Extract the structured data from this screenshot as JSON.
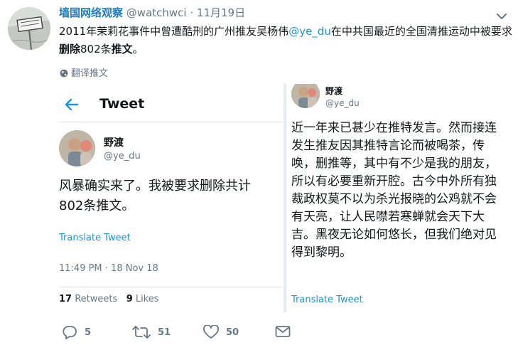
{
  "tweet": {
    "display_name": "墙国网络观察",
    "handle": "@watchwci",
    "separator": "·",
    "date": "11月19日",
    "text_part1": "2011年茉莉花事件中曾遭酷刑的广州推友吴杨伟",
    "text_mention": "@ye_du",
    "text_part2": "在中共国最近的全国清推运动中被要求",
    "text_bold1": "删除",
    "text_part3": "802条",
    "text_bold2": "推文",
    "text_part4": "。",
    "translate_label": "翻译推文",
    "colors": {
      "name": "#1e7bc4",
      "link": "#1b95e0",
      "muted": "#657786"
    }
  },
  "embed_left": {
    "topbar_title": "Tweet",
    "display_name": "野渡",
    "handle": "@ye_du",
    "text_line1": "风暴确实来了。我被要求删除共计",
    "text_line2": "802条推文。",
    "translate_label": "Translate Tweet",
    "timestamp": "11:49 PM · 18 Nov 18",
    "retweets_count": "17",
    "retweets_label": " Retweets",
    "likes_count": "9",
    "likes_label": " Likes"
  },
  "embed_right": {
    "display_name": "野渡",
    "handle": "@ye_du",
    "text": "近一年来已甚少在推特发言。然而接连发生推友因其推特言论而被喝茶，传唤，删推等，其中有不少是我的朋友，所以有必要重新开腔。古今中外所有独裁政权莫不以为杀光报晓的公鸡就不会有天亮，让人民噤若寒蝉就会天下大吉。黑夜无论如何悠长，但我们绝对见得到黎明。",
    "translate_label": "Translate Tweet"
  },
  "actions": {
    "replies": "5",
    "retweets": "51",
    "likes": "50"
  }
}
